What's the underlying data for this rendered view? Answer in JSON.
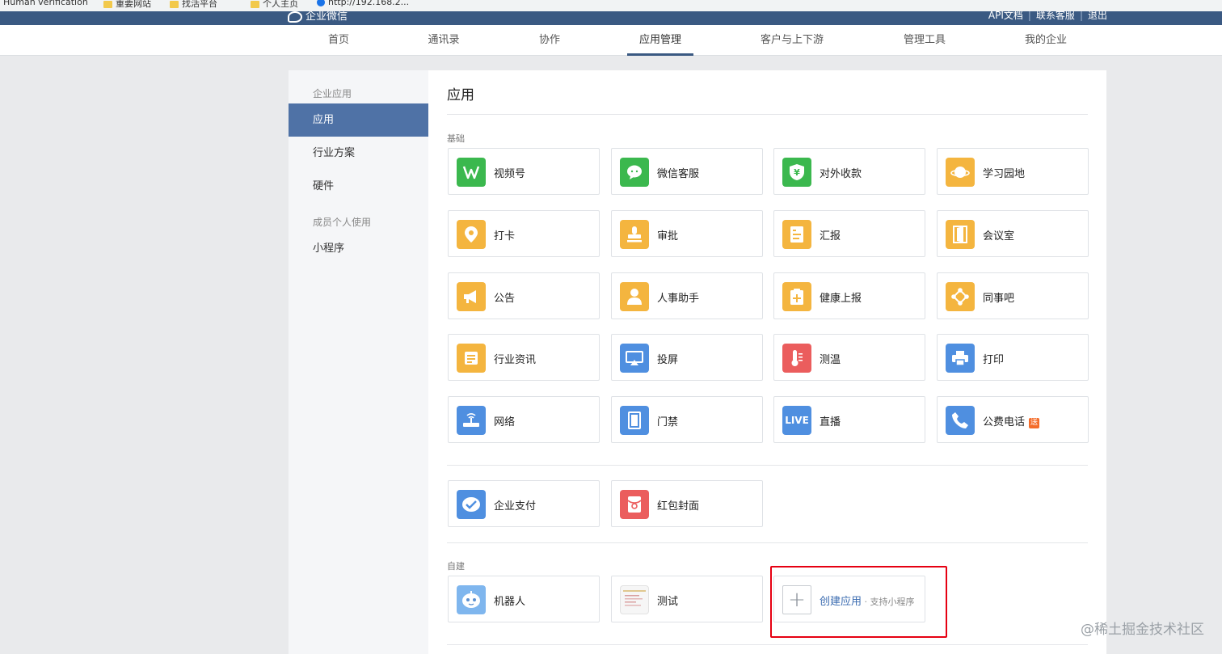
{
  "bookmarks": [
    {
      "label": "Human verification",
      "icon": "globe-icon"
    },
    {
      "label": "重要网站",
      "icon": "folder-icon"
    },
    {
      "label": "找活平台",
      "icon": "folder-icon"
    },
    {
      "label": "个人主页",
      "icon": "folder-icon"
    },
    {
      "label": "http://192.168.2...",
      "icon": "globe-icon"
    }
  ],
  "header": {
    "logo": "企业微信",
    "links": [
      "API文档",
      "联系客服",
      "退出"
    ]
  },
  "nav": {
    "items": [
      "首页",
      "通讯录",
      "协作",
      "应用管理",
      "客户与上下游",
      "管理工具",
      "我的企业"
    ],
    "active": "应用管理"
  },
  "sidebar": {
    "group1": "企业应用",
    "items1": [
      "应用",
      "行业方案",
      "硬件"
    ],
    "group2": "成员个人使用",
    "items2": [
      "小程序"
    ]
  },
  "main": {
    "title": "应用",
    "section_basic": "基础",
    "basic_apps": [
      {
        "label": "视频号",
        "icon": "channels-icon",
        "color": "#3bb84e"
      },
      {
        "label": "微信客服",
        "icon": "chat-bubble-icon",
        "color": "#3bb84e"
      },
      {
        "label": "对外收款",
        "icon": "yuan-shield-icon",
        "color": "#3bb84e"
      },
      {
        "label": "学习园地",
        "icon": "planet-icon",
        "color": "#f4b53f"
      },
      {
        "label": "打卡",
        "icon": "location-pin-icon",
        "color": "#f4b53f"
      },
      {
        "label": "审批",
        "icon": "stamp-icon",
        "color": "#f4b53f"
      },
      {
        "label": "汇报",
        "icon": "report-doc-icon",
        "color": "#f4b53f"
      },
      {
        "label": "会议室",
        "icon": "door-icon",
        "color": "#f4b53f"
      },
      {
        "label": "公告",
        "icon": "megaphone-icon",
        "color": "#f4b53f"
      },
      {
        "label": "人事助手",
        "icon": "person-icon",
        "color": "#f4b53f"
      },
      {
        "label": "健康上报",
        "icon": "health-clipboard-icon",
        "color": "#f4b53f"
      },
      {
        "label": "同事吧",
        "icon": "network-nodes-icon",
        "color": "#f4b53f"
      },
      {
        "label": "行业资讯",
        "icon": "news-scroll-icon",
        "color": "#f4b53f"
      },
      {
        "label": "投屏",
        "icon": "screen-cast-icon",
        "color": "#4f8fe0"
      },
      {
        "label": "测温",
        "icon": "thermometer-icon",
        "color": "#eb5d5d"
      },
      {
        "label": "打印",
        "icon": "printer-icon",
        "color": "#4f8fe0"
      },
      {
        "label": "网络",
        "icon": "router-icon",
        "color": "#4f8fe0"
      },
      {
        "label": "门禁",
        "icon": "access-door-icon",
        "color": "#4f8fe0"
      },
      {
        "label": "直播",
        "icon": "live-icon",
        "color": "#4f8fe0",
        "glyph": "LIVE"
      },
      {
        "label": "公费电话",
        "icon": "phone-icon",
        "color": "#4f8fe0",
        "badge": "送"
      }
    ],
    "payment_apps": [
      {
        "label": "企业支付",
        "icon": "payment-check-icon",
        "color": "#4f8fe0"
      },
      {
        "label": "红包封面",
        "icon": "red-envelope-icon",
        "color": "#eb5d5d"
      }
    ],
    "section_custom": "自建",
    "custom_apps": [
      {
        "label": "机器人",
        "icon": "robot-icon",
        "color": "#7fb6ee"
      },
      {
        "label": "测试",
        "icon": "test-thumbnail-icon",
        "color": "#f6f6f6"
      }
    ],
    "create": {
      "label": "创建应用",
      "sub": " · 支持小程序"
    }
  },
  "watermark": "@稀土掘金技术社区"
}
